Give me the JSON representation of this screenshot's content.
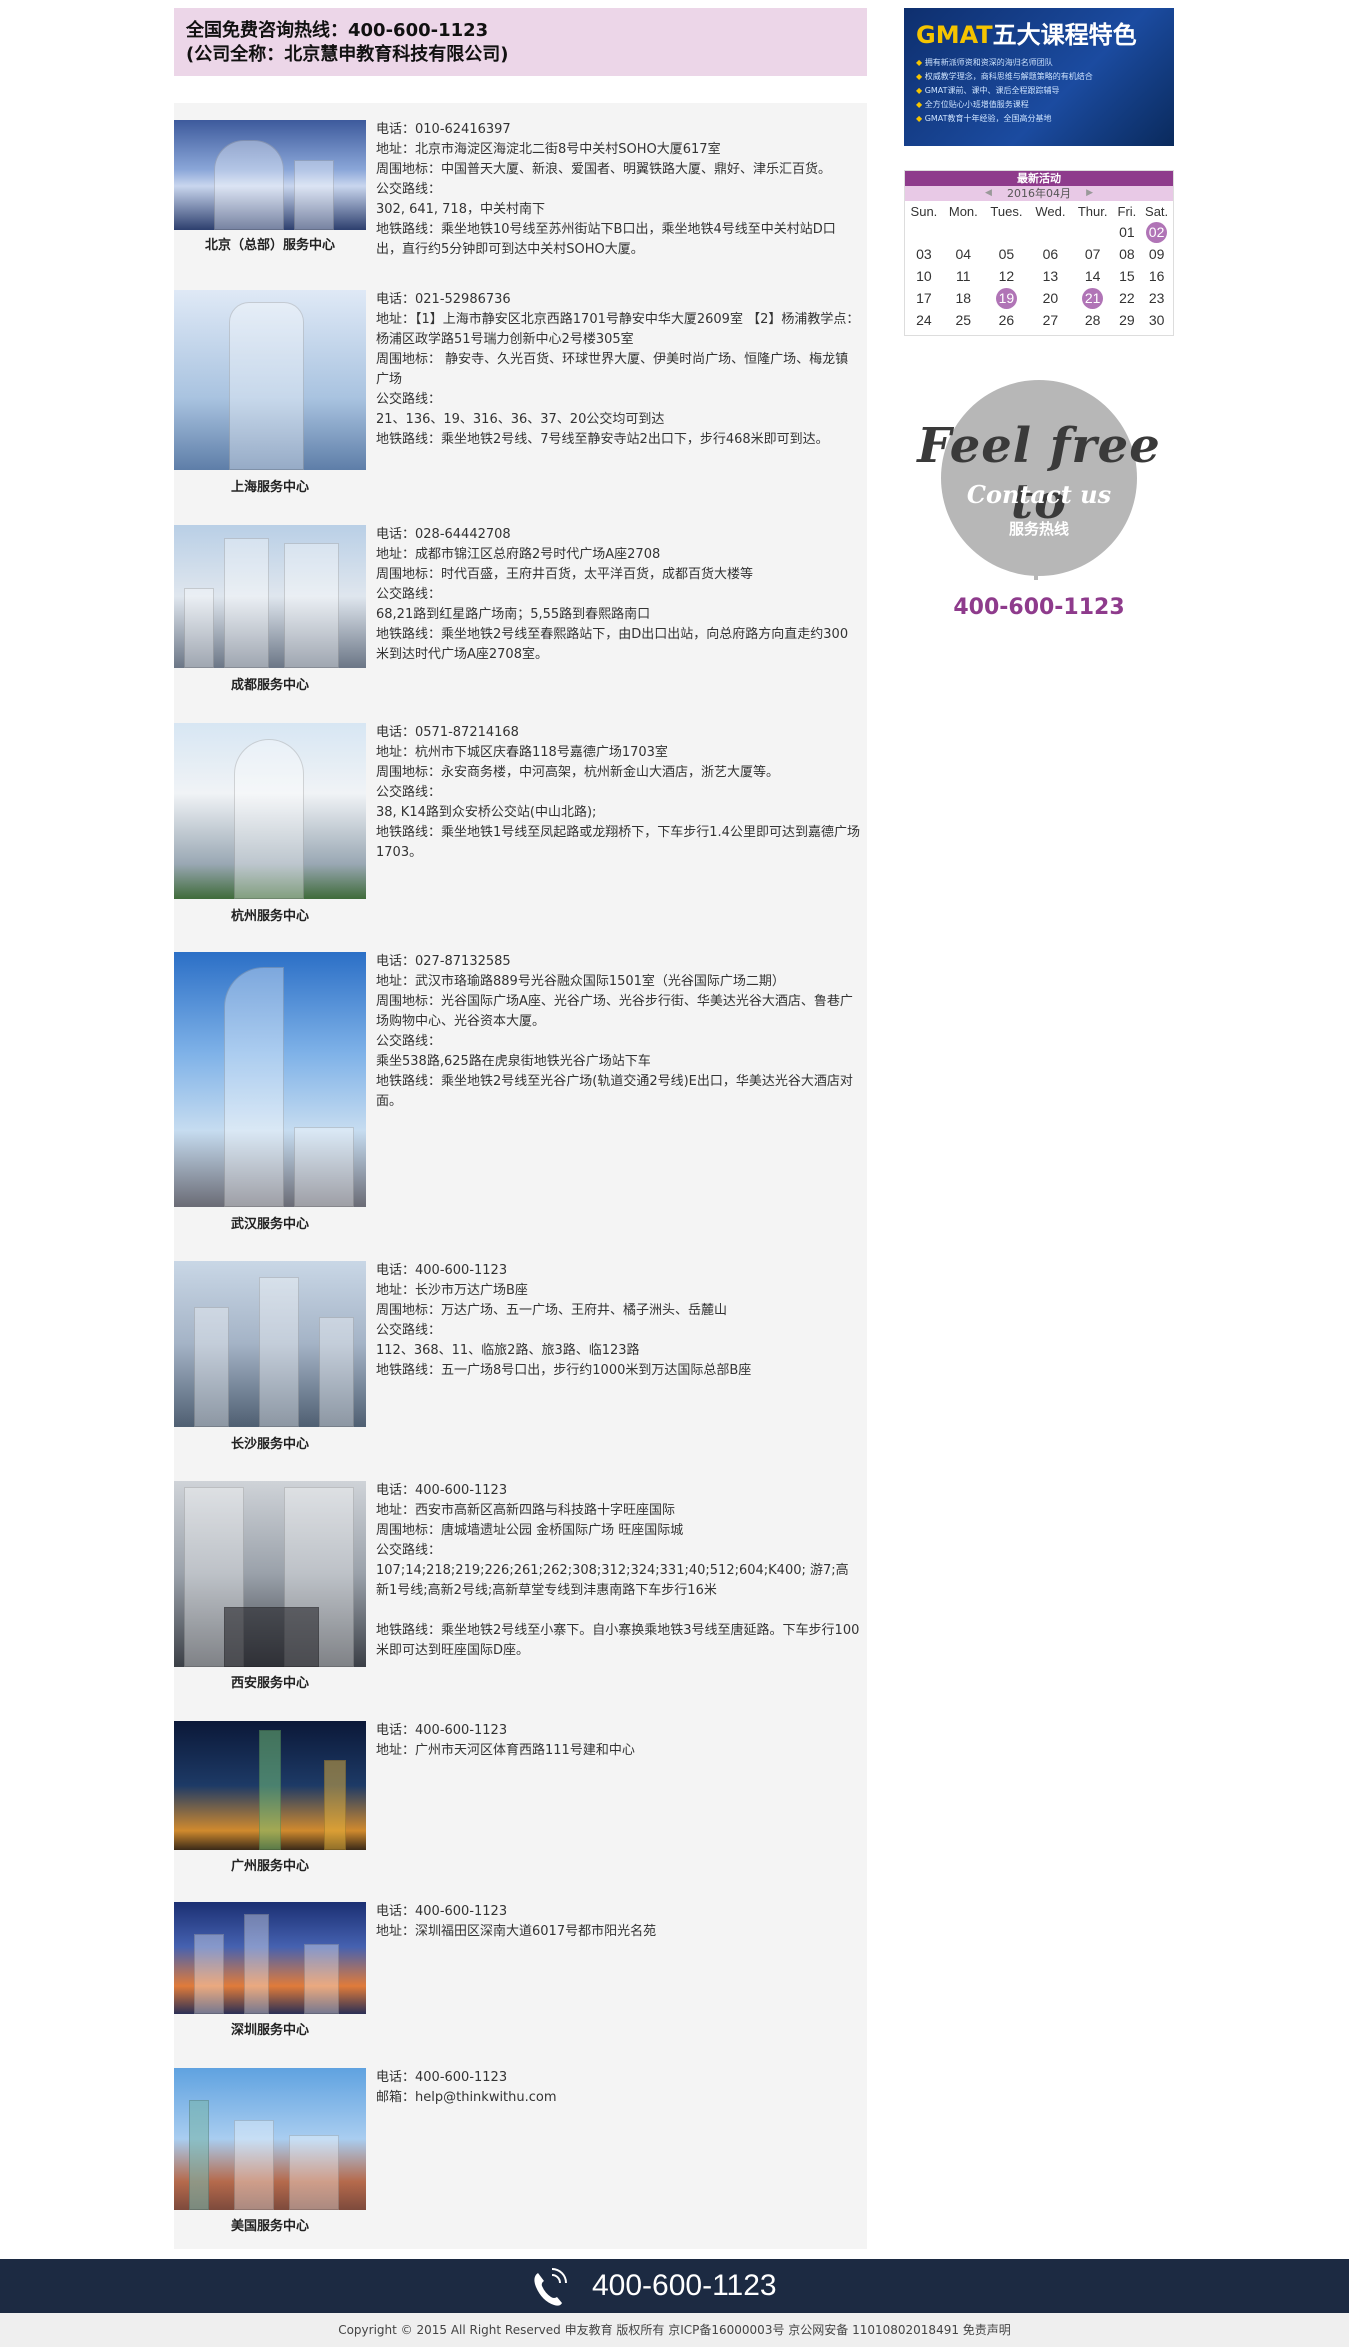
{
  "hotline": {
    "line1": "全国免费咨询热线：400-600-1123",
    "line2": "(公司全称：北京慧申教育科技有限公司)"
  },
  "centers": [
    {
      "name": "北京（总部）服务中心",
      "lines": [
        "电话：010-62416397",
        "地址：北京市海淀区海淀北二街8号中关村SOHO大厦617室",
        "周围地标：中国普天大厦、新浪、爱国者、明翼铁路大厦、鼎好、津乐汇百货。",
        "公交路线：",
        "302, 641, 718，中关村南下",
        "地铁路线：乘坐地铁10号线至苏州街站下B口出，乘坐地铁4号线至中关村站D口出，直行约5分钟即可到达中关村SOHO大厦。"
      ]
    },
    {
      "name": "上海服务中心",
      "lines": [
        "电话：021-52986736",
        "地址：【1】上海市静安区北京西路1701号静安中华大厦2609室 【2】杨浦教学点：杨浦区政学路51号瑞力创新中心2号楼305室",
        "周围地标： 静安寺、久光百货、环球世界大厦、伊美时尚广场、恒隆广场、梅龙镇广场",
        "公交路线：",
        "21、136、19、316、36、37、20公交均可到达",
        "地铁路线：乘坐地铁2号线、7号线至静安寺站2出口下，步行468米即可到达。"
      ]
    },
    {
      "name": "成都服务中心",
      "lines": [
        "电话：028-64442708",
        "地址：成都市锦江区总府路2号时代广场A座2708",
        "周围地标：时代百盛，王府井百货，太平洋百货，成都百货大楼等",
        "公交路线：",
        "68,21路到红星路广场南；5,55路到春熙路南口",
        "地铁路线：乘坐地铁2号线至春熙路站下，由D出口出站，向总府路方向直走约300米到达时代广场A座2708室。"
      ]
    },
    {
      "name": "杭州服务中心",
      "lines": [
        "电话：0571-87214168",
        "地址：杭州市下城区庆春路118号嘉德广场1703室",
        "周围地标：永安商务楼，中河高架，杭州新金山大酒店，浙艺大厦等。",
        "公交路线：",
        "38, K14路到众安桥公交站(中山北路);",
        "地铁路线：乘坐地铁1号线至凤起路或龙翔桥下，下车步行1.4公里即可达到嘉德广场1703。"
      ]
    },
    {
      "name": "武汉服务中心",
      "lines": [
        "电话：027-87132585",
        "地址：武汉市珞瑜路889号光谷融众国际1501室（光谷国际广场二期）",
        "周围地标：光谷国际广场A座、光谷广场、光谷步行街、华美达光谷大酒店、鲁巷广场购物中心、光谷资本大厦。",
        "公交路线：",
        "乘坐538路,625路在虎泉街地铁光谷广场站下车",
        "地铁路线：乘坐地铁2号线至光谷广场(轨道交通2号线)E出口，华美达光谷大酒店对面。"
      ]
    },
    {
      "name": "长沙服务中心",
      "lines": [
        "电话：400-600-1123",
        "地址：长沙市万达广场B座",
        "周围地标：万达广场、五一广场、王府井、橘子洲头、岳麓山",
        "公交路线：",
        "112、368、11、临旅2路、旅3路、临123路",
        "地铁路线：五一广场8号口出，步行约1000米到万达国际总部B座"
      ]
    },
    {
      "name": "西安服务中心",
      "lines": [
        "电话：400-600-1123",
        "地址：西安市高新区高新四路与科技路十字旺座国际",
        "周围地标：唐城墙遗址公园 金桥国际广场 旺座国际城",
        "公交路线：",
        "107;14;218;219;226;261;262;308;312;324;331;40;512;604;K400; 游7;高新1号线;高新2号线;高新草堂专线到沣惠南路下车步行16米",
        "",
        "地铁路线：乘坐地铁2号线至小寨下。自小寨换乘地铁3号线至唐延路。下车步行100米即可达到旺座国际D座。"
      ]
    },
    {
      "name": "广州服务中心",
      "lines": [
        "电话：400-600-1123",
        "地址：广州市天河区体育西路111号建和中心"
      ]
    },
    {
      "name": "深圳服务中心",
      "lines": [
        "电话：400-600-1123",
        "地址：深圳福田区深南大道6017号都市阳光名苑"
      ]
    },
    {
      "name": "美国服务中心",
      "lines": [
        "电话：400-600-1123",
        "邮箱：help@thinkwithu.com"
      ]
    }
  ],
  "sidebar": {
    "gmat_banner": {
      "title_brand": "GMAT",
      "title_rest": "五大课程特色",
      "bullets": [
        "拥有新派师资和资深的海归名师团队",
        "权威教学理念，商科思维与解题策略的有机结合",
        "GMAT课前、课中、课后全程跟踪辅导",
        "全方位贴心小班增值服务课程",
        "GMAT教育十年经验，全国高分基地"
      ]
    },
    "calendar": {
      "header": "最新活动",
      "month": "2016年04月",
      "prev_icon": "chevron-left-icon",
      "next_icon": "chevron-right-icon",
      "weekdays": [
        "Sun.",
        "Mon.",
        "Tues.",
        "Wed.",
        "Thur.",
        "Fri.",
        "Sat."
      ],
      "weeks": [
        [
          "",
          "",
          "",
          "",
          "",
          "01",
          "02"
        ],
        [
          "03",
          "04",
          "05",
          "06",
          "07",
          "08",
          "09"
        ],
        [
          "10",
          "11",
          "12",
          "13",
          "14",
          "15",
          "16"
        ],
        [
          "17",
          "18",
          "19",
          "20",
          "21",
          "22",
          "23"
        ],
        [
          "24",
          "25",
          "26",
          "27",
          "28",
          "29",
          "30"
        ]
      ],
      "marked": [
        "02",
        "19",
        "21"
      ],
      "mark_color": "#b074b6"
    },
    "contact": {
      "feel_text": "Feel free to",
      "contact_text": "Contact us",
      "service_label": "服务热线",
      "phone": "400-600-1123"
    }
  },
  "footer": {
    "phone_icon": "phone-icon",
    "phone": "400-600-1123",
    "copyright": "Copyright © 2015 All Right Reserved 申友教育 版权所有 京ICP备16000003号 京公网安备 11010802018491 免责声明"
  },
  "colors": {
    "hotline_bg": "#ecd6e8",
    "accent_purple": "#8e3b8c",
    "footer_bg": "#1c2a42",
    "content_bg": "#f4f4f4"
  }
}
